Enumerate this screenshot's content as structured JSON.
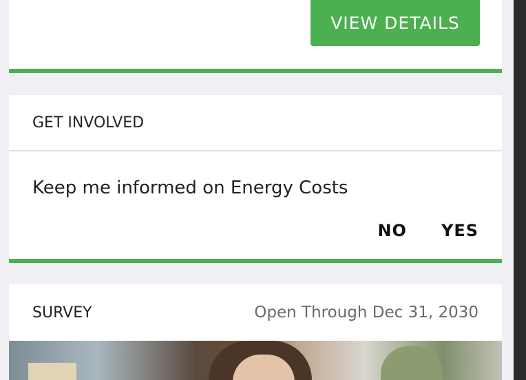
{
  "top_card": {
    "button_label": "VIEW DETAILS",
    "accent_color": "#4caf50"
  },
  "get_involved": {
    "header": "GET INVOLVED",
    "prompt": "Keep me informed on Energy Costs",
    "no_label": "NO",
    "yes_label": "YES"
  },
  "survey": {
    "header": "SURVEY",
    "date_text": "Open Through Dec 31, 2030",
    "image_subject": "woman-photo"
  }
}
